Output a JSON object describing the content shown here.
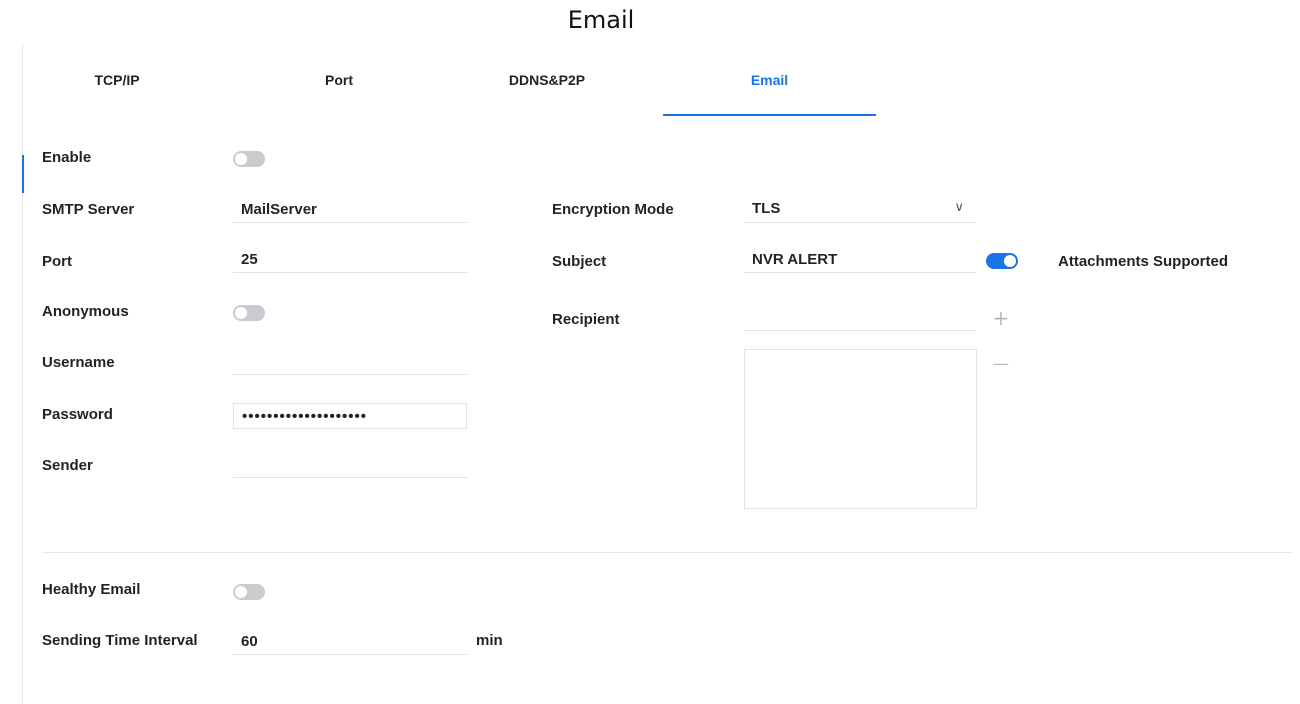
{
  "page": {
    "title": "Email"
  },
  "tabs": [
    {
      "label": "TCP/IP"
    },
    {
      "label": "Port"
    },
    {
      "label": "DDNS&P2P"
    },
    {
      "label": "Email"
    }
  ],
  "form": {
    "enable": {
      "label": "Enable",
      "on": false
    },
    "smtp_server": {
      "label": "SMTP Server",
      "value": "MailServer"
    },
    "port": {
      "label": "Port",
      "value": "25"
    },
    "anonymous": {
      "label": "Anonymous",
      "on": false
    },
    "username": {
      "label": "Username",
      "value": ""
    },
    "password": {
      "label": "Password",
      "value": "••••••••••••••••••••"
    },
    "sender": {
      "label": "Sender",
      "value": ""
    },
    "encryption_mode": {
      "label": "Encryption Mode",
      "value": "TLS",
      "chevron": "∨"
    },
    "subject": {
      "label": "Subject",
      "value": "NVR ALERT"
    },
    "attachments": {
      "label": "Attachments Supported",
      "on": true
    },
    "recipient": {
      "label": "Recipient",
      "value": "",
      "add_symbol": "+",
      "remove_symbol": "—"
    },
    "healthy_email": {
      "label": "Healthy Email",
      "on": false
    },
    "sending_interval": {
      "label": "Sending Time Interval",
      "value": "60",
      "unit": "min"
    }
  },
  "colors": {
    "accent": "#1a73e8",
    "toggle_off": "#c8cbd0",
    "border": "#dfe1e5"
  }
}
